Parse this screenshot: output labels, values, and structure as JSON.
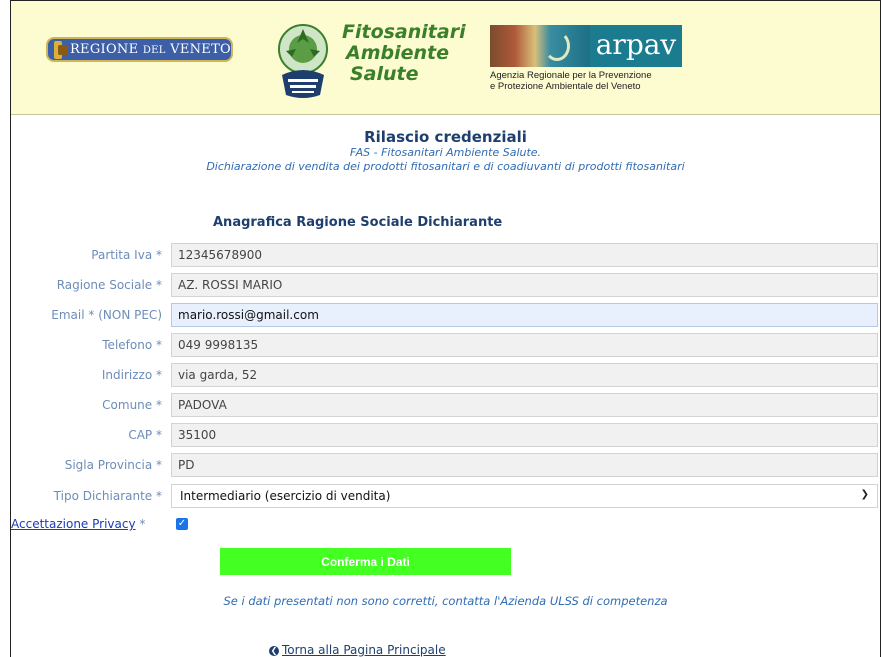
{
  "header": {
    "region_logo": {
      "text_main": "REGIONE",
      "text_small": "DEL",
      "text_end": "VENETO"
    },
    "fas_logo": {
      "line1": "Fitosanitari",
      "line2": "Ambiente",
      "line3": "Salute"
    },
    "arpav_logo": {
      "name": "arpav",
      "desc_line1": "Agenzia Regionale per la Prevenzione",
      "desc_line2": "e Protezione Ambientale del Veneto"
    }
  },
  "page": {
    "title": "Rilascio credenziali",
    "subtitle": "FAS - Fitosanitari Ambiente Salute.",
    "description": "Dichiarazione di vendita dei prodotti fitosanitari e di coadiuvanti di prodotti fitosanitari",
    "section_title": "Anagrafica Ragione Sociale Dichiarante"
  },
  "form": {
    "fields": [
      {
        "label": "Partita Iva",
        "required": "*",
        "value": "12345678900"
      },
      {
        "label": "Ragione Sociale",
        "required": "*",
        "value": "AZ. ROSSI MARIO"
      },
      {
        "label": "Email",
        "required": "* (NON PEC)",
        "value": "mario.rossi@gmail.com"
      },
      {
        "label": "Telefono",
        "required": "*",
        "value": "049 9998135"
      },
      {
        "label": "Indirizzo",
        "required": "*",
        "value": "via garda, 52"
      },
      {
        "label": "Comune",
        "required": "*",
        "value": "PADOVA"
      },
      {
        "label": "CAP",
        "required": "*",
        "value": "35100"
      },
      {
        "label": "Sigla Provincia",
        "required": "*",
        "value": "PD"
      }
    ],
    "tipo": {
      "label": "Tipo Dichiarante",
      "required": "*",
      "selected": "Intermediario (esercizio di vendita)"
    },
    "privacy": {
      "label": "Accettazione Privacy",
      "required": "*",
      "checked": true
    },
    "submit_label": "Conferma i Dati"
  },
  "footer": {
    "note": "Se i dati presentati non sono corretti, contatta l'Azienda ULSS di competenza",
    "back_link": "Torna alla Pagina Principale"
  },
  "colors": {
    "accent_green": "#44ff22",
    "label_blue": "#6d8db8",
    "title_navy": "#1e3f6e",
    "header_bg": "#fdfbd0"
  }
}
